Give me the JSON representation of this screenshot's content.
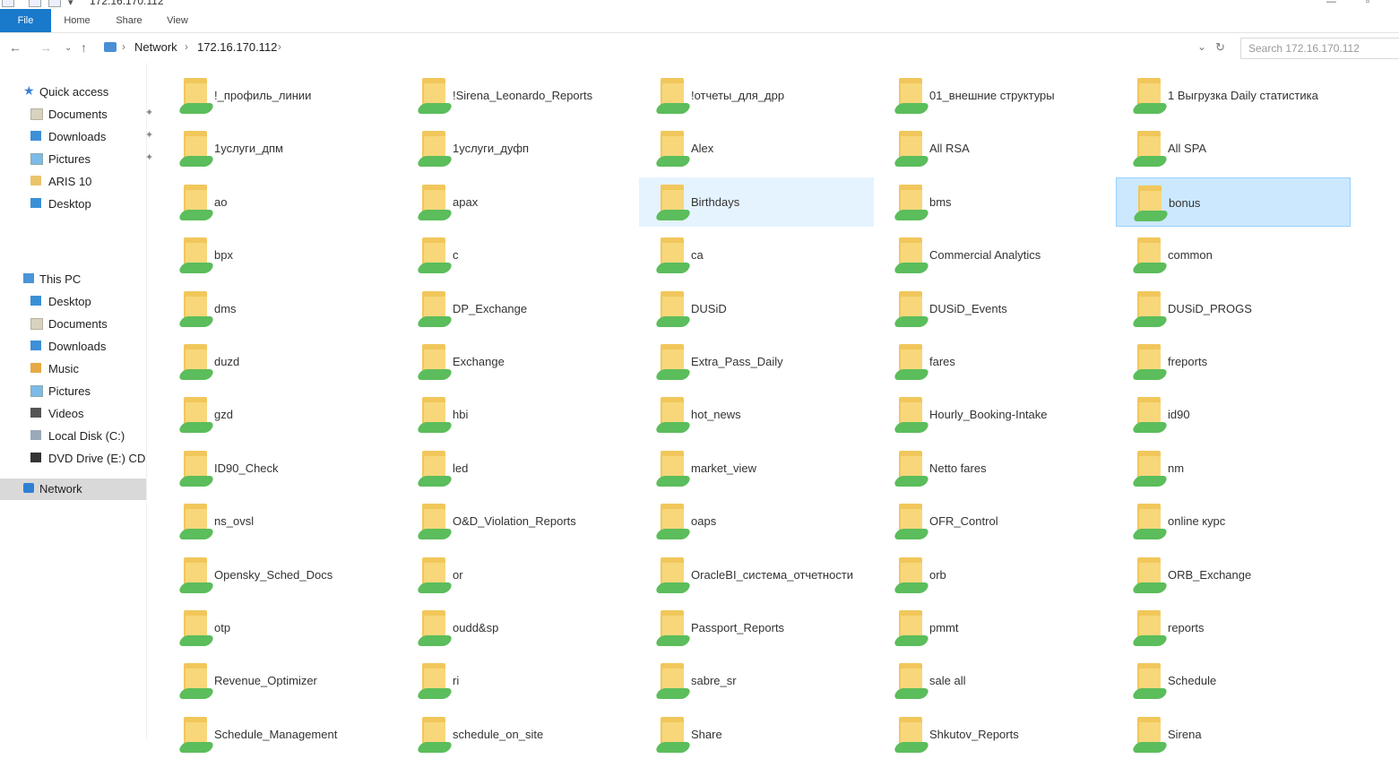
{
  "window": {
    "title": "172.16.170.112"
  },
  "ribbon": {
    "tabs": [
      "File",
      "Home",
      "Share",
      "View"
    ]
  },
  "address": {
    "crumbs": [
      "Network",
      "172.16.170.112"
    ]
  },
  "search": {
    "placeholder": "Search 172.16.170.112"
  },
  "sidebar": {
    "quick_access": "Quick access",
    "quick_items": [
      "Documents",
      "Downloads",
      "Pictures",
      "ARIS 10",
      "Desktop"
    ],
    "this_pc": "This PC",
    "pc_items": [
      "Desktop",
      "Documents",
      "Downloads",
      "Music",
      "Pictures",
      "Videos",
      "Local Disk (C:)",
      "DVD Drive (E:) CDRO"
    ],
    "network": "Network"
  },
  "folders": [
    [
      "!_профиль_линии",
      "!Sirena_Leonardo_Reports",
      "!отчеты_для_дрр",
      "01_внешние структуры",
      "1 Выгрузка Daily статистика"
    ],
    [
      "1услуги_дпм",
      "1услуги_дуфп",
      "Alex",
      "All RSA",
      "All SPA"
    ],
    [
      "ao",
      "apax",
      "Birthdays",
      "bms",
      "bonus"
    ],
    [
      "bpx",
      "c",
      "ca",
      "Commercial Analytics",
      "common"
    ],
    [
      "dms",
      "DP_Exchange",
      "DUSiD",
      "DUSiD_Events",
      "DUSiD_PROGS"
    ],
    [
      "duzd",
      "Exchange",
      "Extra_Pass_Daily",
      "fares",
      "freports"
    ],
    [
      "gzd",
      "hbi",
      "hot_news",
      "Hourly_Booking-Intake",
      "id90"
    ],
    [
      "ID90_Check",
      "led",
      "market_view",
      "Netto fares",
      "nm"
    ],
    [
      "ns_ovsl",
      "O&D_Violation_Reports",
      "oaps",
      "OFR_Control",
      "online курс"
    ],
    [
      "Opensky_Sched_Docs",
      "or",
      "OracleBI_система_отчетности",
      "orb",
      "ORB_Exchange"
    ],
    [
      "otp",
      "oudd&sp",
      "Passport_Reports",
      "pmmt",
      "reports"
    ],
    [
      "Revenue_Optimizer",
      "ri",
      "sabre_sr",
      "sale all",
      "Schedule"
    ],
    [
      "Schedule_Management",
      "schedule_on_site",
      "Share",
      "Shkutov_Reports",
      "Sirena"
    ]
  ],
  "selected_folder": "bonus",
  "hover_folder": "Birthdays"
}
